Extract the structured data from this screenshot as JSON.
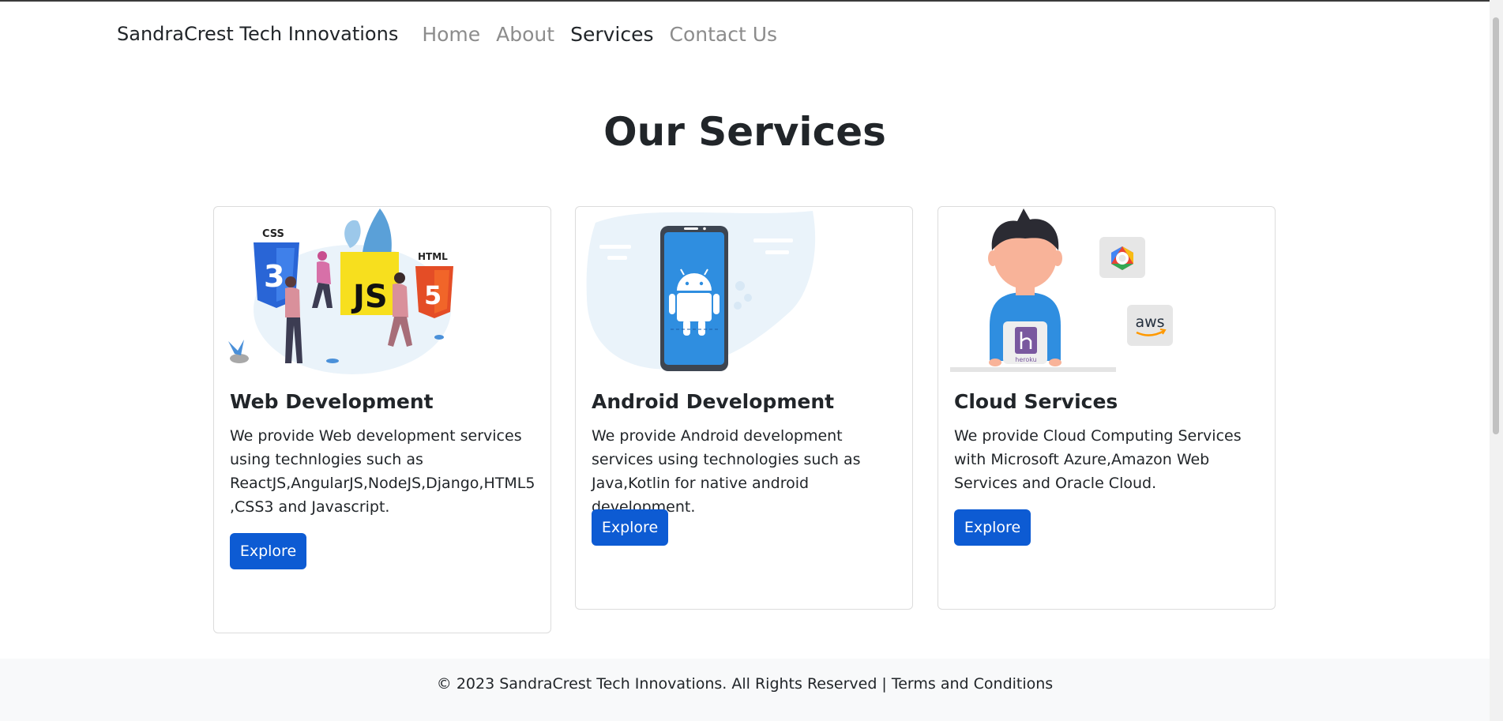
{
  "navbar": {
    "brand": "SandraCrest Tech Innovations",
    "links": [
      "Home",
      "About",
      "Services",
      "Contact Us"
    ],
    "active": "Services"
  },
  "page": {
    "title": "Our Services"
  },
  "services": [
    {
      "title": "Web Development",
      "text": "We provide Web development services using technlogies such as ReactJS,AngularJS,NodeJS,Django,HTML5,CSS3 and Javascript.",
      "button": "Explore",
      "image_labels": [
        "CSS",
        "JS",
        "HTML",
        "3",
        "5"
      ]
    },
    {
      "title": "Android Development",
      "text": "We provide Android development services using technologies such as Java,Kotlin for native android development.",
      "button": "Explore"
    },
    {
      "title": "Cloud Services",
      "text": "We provide Cloud Computing Services with Microsoft Azure,Amazon Web Services and Oracle Cloud.",
      "button": "Explore",
      "image_labels": [
        "aws",
        "heroku"
      ]
    }
  ],
  "footer": {
    "copyright": "© 2023 SandraCrest Tech Innovations. All Rights Reserved | ",
    "terms": "Terms and Conditions"
  },
  "colors": {
    "primary_button": "#0d5bd3",
    "footer_bg": "#f8f9fa",
    "nav_inactive": "#8c8c8c",
    "text": "#212529"
  }
}
